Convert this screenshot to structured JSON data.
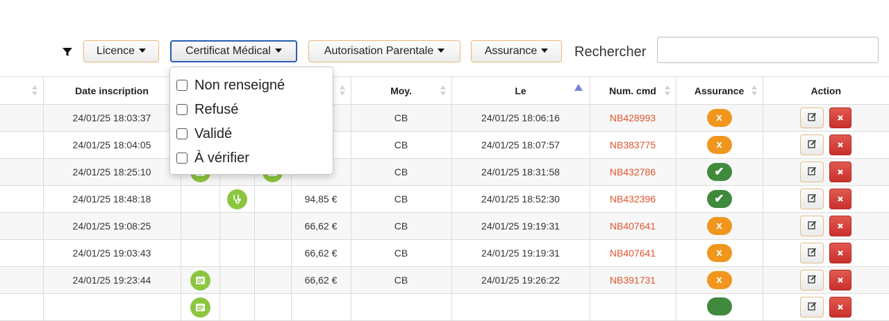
{
  "filters": {
    "licence": "Licence",
    "certificat": "Certificat Médical",
    "autorisation": "Autorisation Parentale",
    "assurance": "Assurance"
  },
  "search": {
    "label": "Rechercher",
    "value": ""
  },
  "dropdown": {
    "options": [
      "Non renseigné",
      "Refusé",
      "Validé",
      "À vérifier"
    ]
  },
  "table": {
    "headers": {
      "date_inscription": "Date inscription",
      "prix": "",
      "moy": "Moy.",
      "le": "Le",
      "num_cmd": "Num. cmd",
      "assurance": "Assurance",
      "action": "Action"
    },
    "rows": [
      {
        "date": "24/01/25 18:03:37",
        "lic": "",
        "cert": "",
        "auth": "",
        "prix": "",
        "moy": "CB",
        "le": "24/01/25 18:06:16",
        "cmd": "NB428993",
        "assur": "x",
        "assur_type": "x"
      },
      {
        "date": "24/01/25 18:04:05",
        "lic": "",
        "cert": "",
        "auth": "",
        "prix": "€",
        "moy": "CB",
        "le": "24/01/25 18:07:57",
        "cmd": "NB383775",
        "assur": "x",
        "assur_type": "x"
      },
      {
        "date": "24/01/25 18:25:10",
        "lic": "doc",
        "cert": "",
        "auth": "doc",
        "prix": "",
        "moy": "CB",
        "le": "24/01/25 18:31:58",
        "cmd": "NB432786",
        "assur": "✔",
        "assur_type": "ok"
      },
      {
        "date": "24/01/25 18:48:18",
        "lic": "",
        "cert": "stethoscope",
        "auth": "",
        "prix": "94,85 €",
        "moy": "CB",
        "le": "24/01/25 18:52:30",
        "cmd": "NB432396",
        "assur": "✔",
        "assur_type": "ok"
      },
      {
        "date": "24/01/25 19:08:25",
        "lic": "",
        "cert": "",
        "auth": "",
        "prix": "66,62 €",
        "moy": "CB",
        "le": "24/01/25 19:19:31",
        "cmd": "NB407641",
        "assur": "x",
        "assur_type": "x"
      },
      {
        "date": "24/01/25 19:03:43",
        "lic": "",
        "cert": "",
        "auth": "",
        "prix": "66,62 €",
        "moy": "CB",
        "le": "24/01/25 19:19:31",
        "cmd": "NB407641",
        "assur": "x",
        "assur_type": "x"
      },
      {
        "date": "24/01/25 19:23:44",
        "lic": "doc",
        "cert": "",
        "auth": "",
        "prix": "66,62 €",
        "moy": "CB",
        "le": "24/01/25 19:26:22",
        "cmd": "NB391731",
        "assur": "x",
        "assur_type": "x"
      },
      {
        "date": "",
        "lic": "doc",
        "cert": "",
        "auth": "",
        "prix": "",
        "moy": "",
        "le": "",
        "cmd": "",
        "assur": "",
        "assur_type": "ok"
      }
    ]
  },
  "icons": {
    "filter": "filter-icon",
    "edit": "edit-icon",
    "delete": "delete-icon",
    "document": "document-icon",
    "stethoscope": "stethoscope-icon"
  },
  "colors": {
    "accent_border": "#e8b87a",
    "active_border": "#2a5db0",
    "badge_warning": "#f0961e",
    "badge_success": "#3f8a3c",
    "link_red": "#e2532c",
    "doc_green": "#8cc63f",
    "delete_red": "#c9302c"
  }
}
